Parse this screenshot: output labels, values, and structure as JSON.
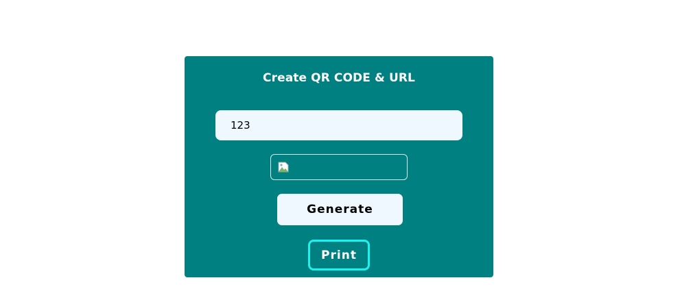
{
  "card": {
    "title": "Create QR CODE & URL",
    "background_color": "#008080"
  },
  "input": {
    "value": "123"
  },
  "qr_image": {
    "icon": "broken-image-icon"
  },
  "buttons": {
    "generate_label": "Generate",
    "print_label": "Print",
    "print_border_color": "#1ef2ee"
  }
}
